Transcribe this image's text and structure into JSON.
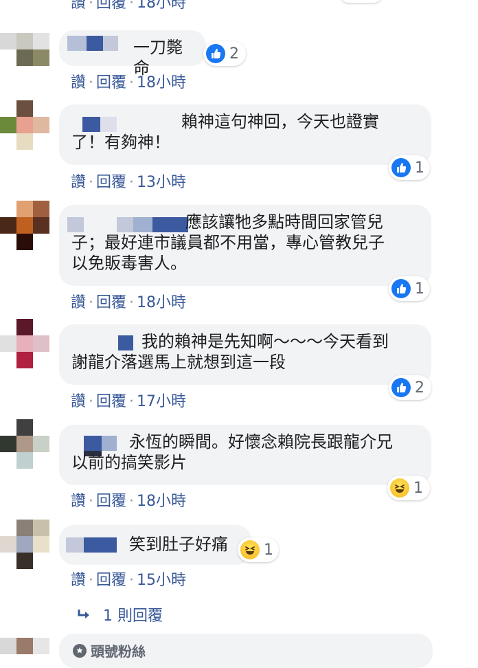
{
  "top_partial": {
    "actions": {
      "like": "讚",
      "reply": "回覆",
      "time": "18小時"
    }
  },
  "comments": [
    {
      "text": "一刀斃命",
      "actions": {
        "like": "讚",
        "reply": "回覆",
        "time": "18小時"
      },
      "reaction": {
        "icon": "like-icon",
        "count": "2"
      }
    },
    {
      "text": "賴神這句神回，今天也證實了！有夠神！",
      "line1": "賴神這句神回，今天也證實",
      "line2": "了！有夠神！",
      "actions": {
        "like": "讚",
        "reply": "回覆",
        "time": "13小時"
      },
      "reaction": {
        "icon": "like-icon",
        "count": "1"
      }
    },
    {
      "line1": "應該讓牠多點時間回家管兒",
      "line2": "子；最好連市議員都不用當，專心管教兒子",
      "line3": "以免販毒害人。",
      "actions": {
        "like": "讚",
        "reply": "回覆",
        "time": "18小時"
      },
      "reaction": {
        "icon": "like-icon",
        "count": "1"
      }
    },
    {
      "line1": "我的賴神是先知啊～～～今天看到",
      "line2": "謝龍介落選馬上就想到這一段",
      "actions": {
        "like": "讚",
        "reply": "回覆",
        "time": "17小時"
      },
      "reaction": {
        "icon": "like-icon",
        "count": "2"
      }
    },
    {
      "line1": "永恆的瞬間。好懷念賴院長跟龍介兄",
      "line2": "以前的搞笑影片",
      "actions": {
        "like": "讚",
        "reply": "回覆",
        "time": "18小時"
      },
      "reaction": {
        "icon": "haha-icon",
        "count": "1"
      }
    },
    {
      "text": "笑到肚子好痛",
      "actions": {
        "like": "讚",
        "reply": "回覆",
        "time": "15小時"
      },
      "reaction": {
        "icon": "haha-icon",
        "count": "1"
      }
    }
  ],
  "reply_link": {
    "icon": "reply-arrow-icon",
    "label": "1 則回覆"
  },
  "top_fan": {
    "icon": "top-fan-icon",
    "label": "頭號粉絲"
  },
  "colors": {
    "link": "#385898",
    "bubble": "#f2f3f5",
    "like": "#1877f2"
  }
}
